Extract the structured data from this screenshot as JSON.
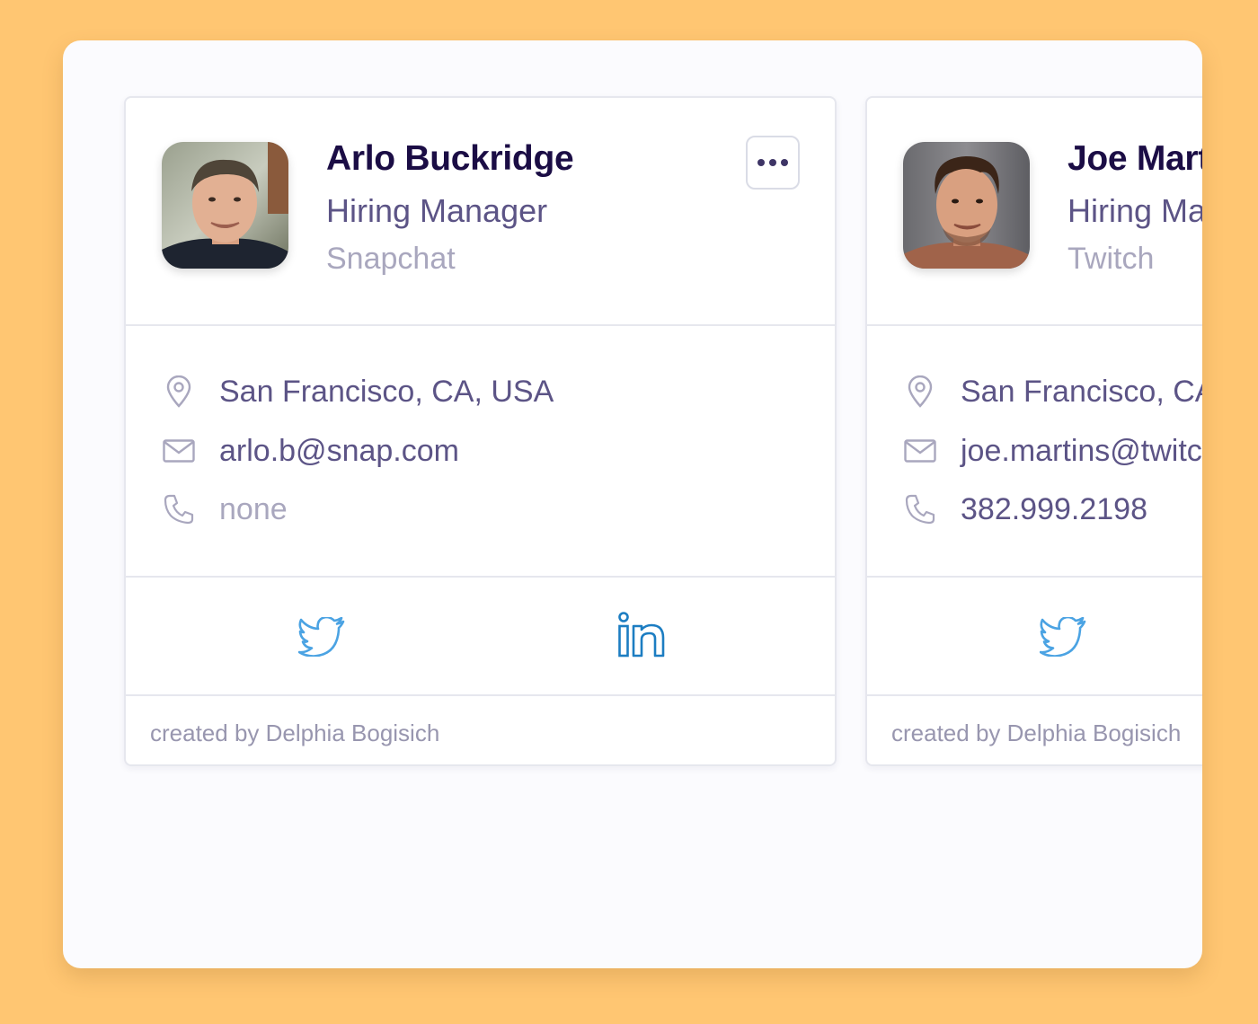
{
  "colors": {
    "background": "#FFC672",
    "panel": "#FBFBFE",
    "name": "#1B0D45",
    "secondary_text": "#5C5486",
    "muted_text": "#A9A7BE",
    "twitter": "#4BA3E3",
    "linkedin": "#1C7DC2"
  },
  "contacts": [
    {
      "name": "Arlo Buckridge",
      "role": "Hiring Manager",
      "company": "Snapchat",
      "location": "San Francisco, CA, USA",
      "email": "arlo.b@snap.com",
      "phone": "none",
      "social": [
        "twitter-icon",
        "linkedin-icon"
      ],
      "footer": "created by Delphia Bogisich"
    },
    {
      "name": "Joe Martins",
      "role": "Hiring Manager",
      "company": "Twitch",
      "location": "San Francisco, CA, USA",
      "email": "joe.martins@twitch.tv",
      "phone": "382.999.2198",
      "social": [
        "twitter-icon"
      ],
      "footer": "created by Delphia Bogisich"
    }
  ],
  "icons": {
    "more": "more-dots-icon",
    "location": "location-pin-icon",
    "email": "envelope-icon",
    "phone": "phone-icon"
  }
}
